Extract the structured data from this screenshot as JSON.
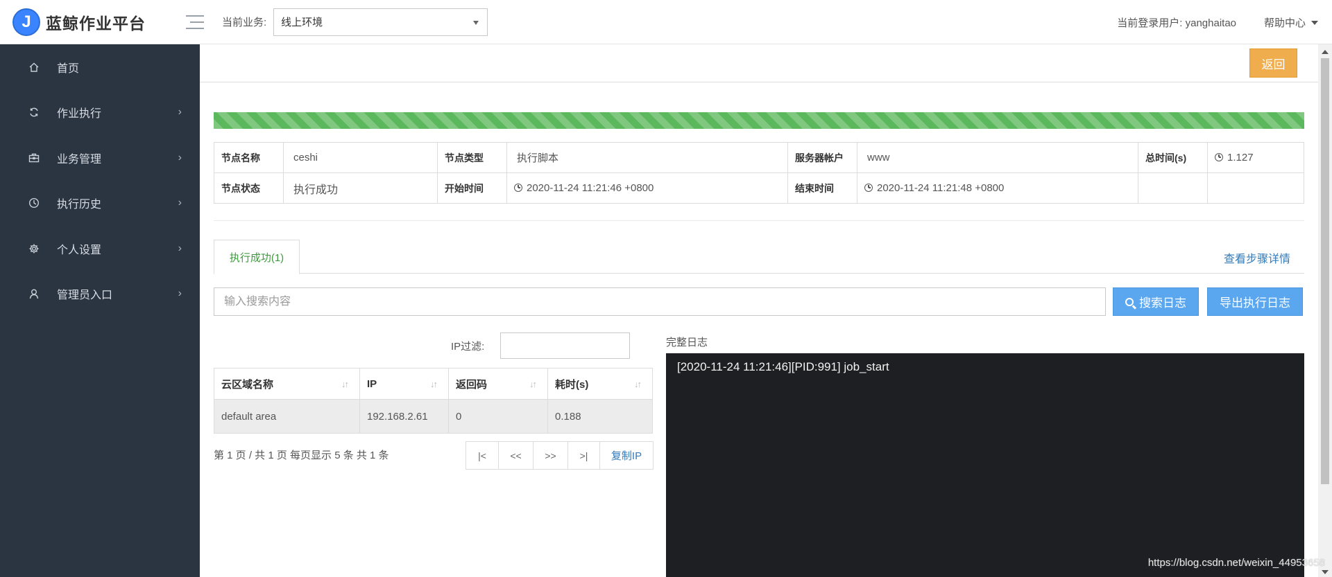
{
  "header": {
    "logo_letter": "J",
    "app_title": "蓝鲸作业平台",
    "biz_label": "当前业务:",
    "biz_value": "线上环境",
    "user_label": "当前登录用户: yanghaitao",
    "help": "帮助中心"
  },
  "sidebar": {
    "items": [
      {
        "label": "首页",
        "icon": "home-icon",
        "has_arrow": false
      },
      {
        "label": "作业执行",
        "icon": "refresh-icon",
        "has_arrow": true
      },
      {
        "label": "业务管理",
        "icon": "briefcase-icon",
        "has_arrow": true
      },
      {
        "label": "执行历史",
        "icon": "clock-icon",
        "has_arrow": true
      },
      {
        "label": "个人设置",
        "icon": "gear-icon",
        "has_arrow": true
      },
      {
        "label": "管理员入口",
        "icon": "user-icon",
        "has_arrow": true
      }
    ],
    "arrow": "›"
  },
  "toolbar": {
    "back_label": "返回"
  },
  "progress": {
    "percent": 100,
    "color": "#5cb85c"
  },
  "info": {
    "node_name_label": "节点名称",
    "node_name": "ceshi",
    "node_type_label": "节点类型",
    "node_type": "执行脚本",
    "server_account_label": "服务器帐户",
    "server_account": "www",
    "total_time_label": "总时间(s)",
    "total_time": "1.127",
    "node_status_label": "节点状态",
    "node_status": "执行成功",
    "start_time_label": "开始时间",
    "start_time": "2020-11-24 11:21:46 +0800",
    "end_time_label": "结束时间",
    "end_time": "2020-11-24 11:21:48 +0800"
  },
  "tabs": {
    "active": "执行成功(1)",
    "step_detail": "查看步骤详情"
  },
  "search": {
    "placeholder": "输入搜索内容",
    "search_button": "搜索日志",
    "export_button": "导出执行日志"
  },
  "ip_filter": {
    "label": "IP过滤:",
    "value": ""
  },
  "ip_table": {
    "columns": [
      "云区域名称",
      "IP",
      "返回码",
      "耗时(s)"
    ],
    "rows": [
      [
        "default area",
        "192.168.2.61",
        "0",
        "0.188"
      ]
    ]
  },
  "pager": {
    "summary": "第 1 页 / 共 1 页  每页显示 5 条  共 1 条",
    "first": "|<",
    "prev": "<<",
    "next": ">>",
    "last": ">|",
    "copy_ip": "复制IP"
  },
  "log": {
    "title": "完整日志",
    "lines": [
      "[2020-11-24 11:21:46][PID:991] job_start"
    ]
  },
  "watermark": "https://blog.csdn.net/weixin_44953658"
}
